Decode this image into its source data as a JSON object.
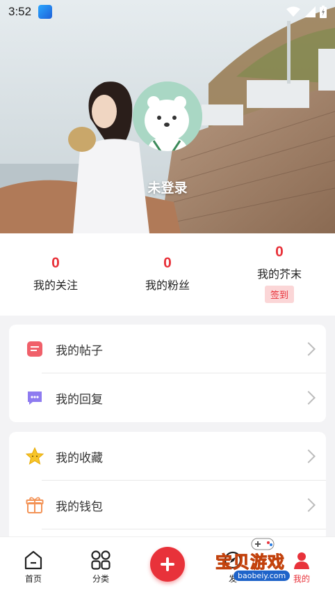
{
  "status_bar": {
    "time": "3:52"
  },
  "profile": {
    "login_text": "未登录"
  },
  "stats": [
    {
      "count": "0",
      "label": "我的关注"
    },
    {
      "count": "0",
      "label": "我的粉丝"
    },
    {
      "count": "0",
      "label": "我的芥末",
      "action": "签到"
    }
  ],
  "menu_group_1": [
    {
      "label": "我的帖子",
      "icon": "post-icon"
    },
    {
      "label": "我的回复",
      "icon": "reply-icon"
    }
  ],
  "menu_group_2": [
    {
      "label": "我的收藏",
      "icon": "star-icon"
    },
    {
      "label": "我的钱包",
      "icon": "gift-icon"
    }
  ],
  "bottom_nav": {
    "home": "首页",
    "category": "分类",
    "publish": "发",
    "mine": "我的"
  },
  "watermark": {
    "brand": "宝贝游戏",
    "url": "baobeiy.com"
  },
  "colors": {
    "accent": "#e8323a",
    "checkin_bg": "#fbd6d7"
  }
}
